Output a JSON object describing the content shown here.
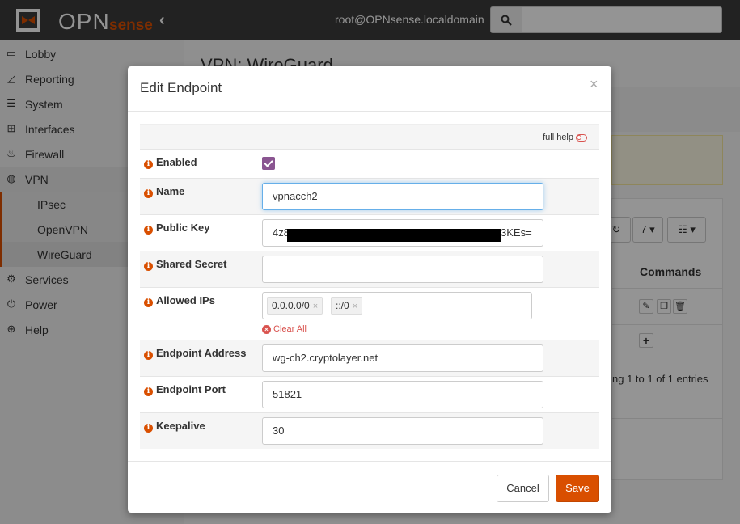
{
  "header": {
    "logo_text": "OPN",
    "logo_sense": "sense",
    "user": "root@OPNsense.localdomain",
    "search_placeholder": ""
  },
  "sidebar": {
    "items": [
      {
        "label": "Lobby",
        "icon": "laptop-icon"
      },
      {
        "label": "Reporting",
        "icon": "area-chart-icon"
      },
      {
        "label": "System",
        "icon": "server-icon"
      },
      {
        "label": "Interfaces",
        "icon": "sitemap-icon"
      },
      {
        "label": "Firewall",
        "icon": "fire-icon"
      },
      {
        "label": "VPN",
        "icon": "globe-icon"
      },
      {
        "label": "IPsec",
        "icon": ""
      },
      {
        "label": "OpenVPN",
        "icon": ""
      },
      {
        "label": "WireGuard",
        "icon": ""
      },
      {
        "label": "Services",
        "icon": "gear-icon"
      },
      {
        "label": "Power",
        "icon": "plug-icon"
      },
      {
        "label": "Help",
        "icon": "lifebuoy-icon"
      }
    ]
  },
  "background": {
    "page_title": "VPN: WireGuard",
    "rows_select": "7",
    "commands_header": "Commands",
    "entries_text": "ng 1 to 1 of 1 entries"
  },
  "modal": {
    "title": "Edit Endpoint",
    "close": "×",
    "full_help": "full help",
    "fields": {
      "enabled": {
        "label": "Enabled",
        "checked": true
      },
      "name": {
        "label": "Name",
        "value": "vpnacch2"
      },
      "public_key": {
        "label": "Public Key",
        "value_start": "4z8",
        "value_end": "3KEs=",
        "redacted": true
      },
      "shared_secret": {
        "label": "Shared Secret",
        "value": ""
      },
      "allowed_ips": {
        "label": "Allowed IPs",
        "tags": [
          "0.0.0.0/0",
          "::/0"
        ],
        "clear_all": "Clear All"
      },
      "endpoint_address": {
        "label": "Endpoint Address",
        "value": "wg-ch2.cryptolayer.net"
      },
      "endpoint_port": {
        "label": "Endpoint Port",
        "value": "51821"
      },
      "keepalive": {
        "label": "Keepalive",
        "value": "30"
      }
    },
    "buttons": {
      "cancel": "Cancel",
      "save": "Save"
    }
  },
  "colors": {
    "accent": "#d94f00",
    "checkbox": "#8a5591",
    "topbar": "#3b3b3b"
  }
}
